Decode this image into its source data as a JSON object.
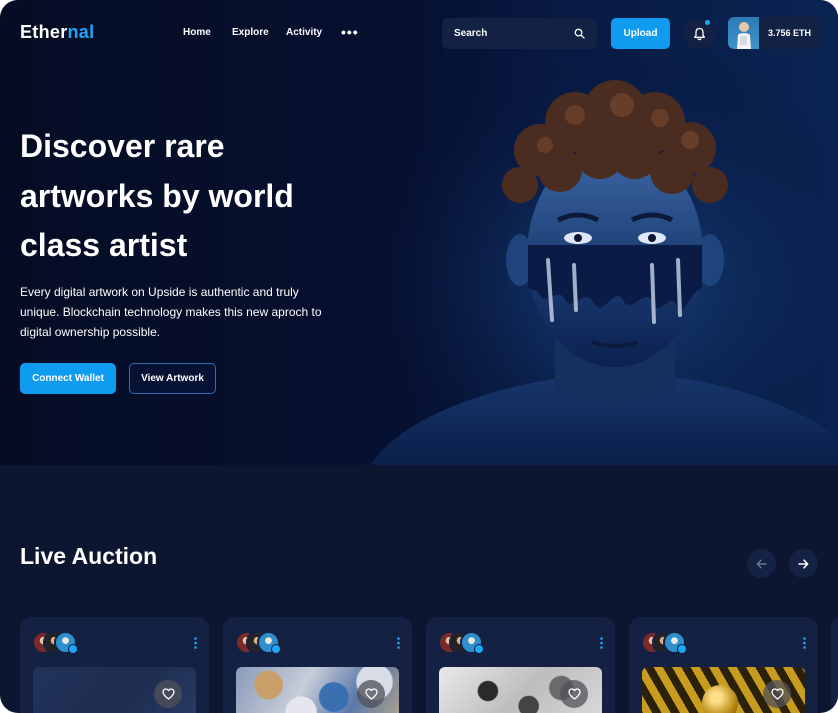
{
  "brand": {
    "name_part1": "Ether",
    "name_part2": "nal",
    "accent_color": "#1ea7f5"
  },
  "nav": {
    "links": [
      {
        "label": "Home"
      },
      {
        "label": "Explore"
      },
      {
        "label": "Activity"
      }
    ],
    "more_label": "•••",
    "more_icon": "more-horizontal-icon"
  },
  "search": {
    "placeholder": "Search",
    "icon": "search-icon"
  },
  "header_actions": {
    "upload_label": "Upload",
    "notification_icon": "bell-icon",
    "notification_indicator": true,
    "wallet_balance": "3.756 ETH"
  },
  "hero": {
    "title_lines": [
      "Discover rare",
      "artworks by world",
      "class artist"
    ],
    "subtitle_lines": [
      "Every digital artwork on Upside is authentic and truly",
      "unique. Blockchain technology makes this new aproch to",
      "digital ownership possible."
    ],
    "primary_button": "Connect Wallet",
    "secondary_button": "View Artwork"
  },
  "live_auction": {
    "title": "Live Auction",
    "prev_icon": "arrow-left-icon",
    "next_icon": "arrow-right-icon",
    "cards": [
      {
        "image": "abstract-dark-blue",
        "favorite_icon": "heart-icon",
        "menu_icon": "more-vertical-icon",
        "verified": true
      },
      {
        "image": "marble-fluid-art",
        "favorite_icon": "heart-icon",
        "menu_icon": "more-vertical-icon",
        "verified": true
      },
      {
        "image": "grayscale-abstract",
        "favorite_icon": "heart-icon",
        "menu_icon": "more-vertical-icon",
        "verified": true
      },
      {
        "image": "gold-spheres",
        "favorite_icon": "heart-icon",
        "menu_icon": "more-vertical-icon",
        "verified": true
      }
    ]
  },
  "colors": {
    "page_bg": "#0c1630",
    "hero_bg": "#061030",
    "primary": "#0f9bf0",
    "card_bg": "#142142"
  }
}
